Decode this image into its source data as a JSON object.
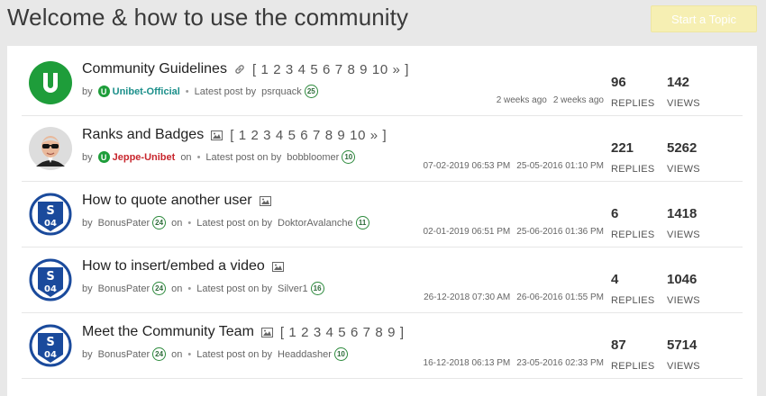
{
  "page": {
    "title": "Welcome & how to use the community",
    "start_topic_label": "Start a Topic"
  },
  "colors": {
    "accent_green": "#1e9d3a",
    "author_red": "#c8262d",
    "button_bg": "#f6efb3"
  },
  "labels": {
    "replies": "REPLIES",
    "views": "VIEWS",
    "by": "by",
    "on": "on"
  },
  "topics": [
    {
      "title": "Community Guidelines",
      "title_icon": "link-icon",
      "pages": "[ 1 2 3 4 5 6 7 8 9 10 » ]",
      "author": "Unibet-Official",
      "author_badge": "",
      "author_on": "",
      "latest_label": "Latest post by",
      "latest_user": "psrquack",
      "latest_rank": "25",
      "started": "2 weeks ago",
      "last": "2 weeks ago",
      "replies": "96",
      "views": "142"
    },
    {
      "title": "Ranks and Badges",
      "title_icon": "image-icon",
      "pages": "[ 1 2 3 4 5 6 7 8 9 10 » ]",
      "author": "Jeppe-Unibet",
      "author_badge": "",
      "author_on": "on",
      "latest_label": "Latest post on by",
      "latest_user": "bobbloomer",
      "latest_rank": "10",
      "started": "07-02-2019 06:53 PM",
      "last": "25-05-2016 01:10 PM",
      "replies": "221",
      "views": "5262"
    },
    {
      "title": "How to quote another user",
      "title_icon": "image-icon",
      "pages": "",
      "author": "BonusPater",
      "author_badge": "24",
      "author_on": "on",
      "latest_label": "Latest post on by",
      "latest_user": "DoktorAvalanche",
      "latest_rank": "11",
      "started": "02-01-2019 06:51 PM",
      "last": "25-06-2016 01:36 PM",
      "replies": "6",
      "views": "1418"
    },
    {
      "title": "How to insert/embed a video",
      "title_icon": "image-icon",
      "pages": "",
      "author": "BonusPater",
      "author_badge": "24",
      "author_on": "on",
      "latest_label": "Latest post on by",
      "latest_user": "Silver1",
      "latest_rank": "16",
      "started": "26-12-2018 07:30 AM",
      "last": "26-06-2016 01:55 PM",
      "replies": "4",
      "views": "1046"
    },
    {
      "title": "Meet the Community Team",
      "title_icon": "image-icon",
      "pages": "[ 1 2 3 4 5 6 7 8 9 ]",
      "author": "BonusPater",
      "author_badge": "24",
      "author_on": "on",
      "latest_label": "Latest post on by",
      "latest_user": "Headdasher",
      "latest_rank": "10",
      "started": "16-12-2018 06:13 PM",
      "last": "23-05-2016 02:33 PM",
      "replies": "87",
      "views": "5714"
    }
  ]
}
